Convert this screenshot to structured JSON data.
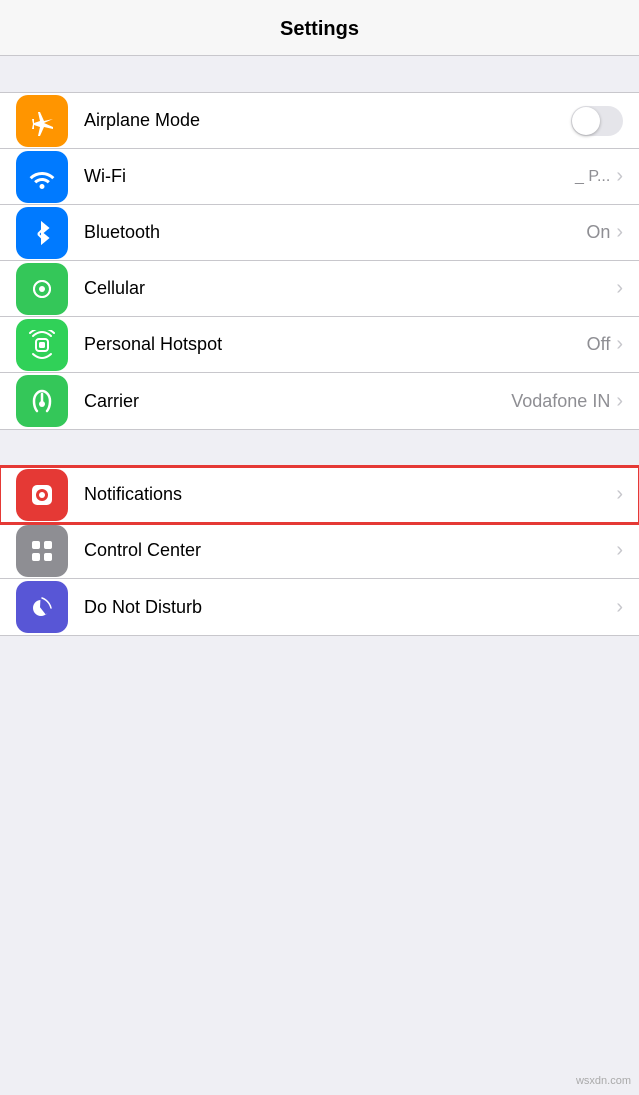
{
  "header": {
    "title": "Settings"
  },
  "groups": [
    {
      "id": "connectivity",
      "items": [
        {
          "id": "airplane-mode",
          "icon": "airplane",
          "icon_color": "orange",
          "label": "Airplane Mode",
          "value": "",
          "has_toggle": true,
          "toggle_on": false,
          "has_chevron": false
        },
        {
          "id": "wifi",
          "icon": "wifi",
          "icon_color": "blue",
          "label": "Wi-Fi",
          "value": "_ P...",
          "has_toggle": false,
          "has_chevron": true
        },
        {
          "id": "bluetooth",
          "icon": "bluetooth",
          "icon_color": "blue",
          "label": "Bluetooth",
          "value": "On",
          "has_toggle": false,
          "has_chevron": true
        },
        {
          "id": "cellular",
          "icon": "cellular",
          "icon_color": "green",
          "label": "Cellular",
          "value": "",
          "has_toggle": false,
          "has_chevron": true
        },
        {
          "id": "personal-hotspot",
          "icon": "hotspot",
          "icon_color": "green",
          "label": "Personal Hotspot",
          "value": "Off",
          "has_toggle": false,
          "has_chevron": true
        },
        {
          "id": "carrier",
          "icon": "carrier",
          "icon_color": "green",
          "label": "Carrier",
          "value": "Vodafone IN",
          "has_toggle": false,
          "has_chevron": true
        }
      ]
    },
    {
      "id": "system",
      "items": [
        {
          "id": "notifications",
          "icon": "notifications",
          "icon_color": "red",
          "label": "Notifications",
          "value": "",
          "has_toggle": false,
          "has_chevron": true,
          "highlighted": true
        },
        {
          "id": "control-center",
          "icon": "control-center",
          "icon_color": "gray",
          "label": "Control Center",
          "value": "",
          "has_toggle": false,
          "has_chevron": true
        },
        {
          "id": "do-not-disturb",
          "icon": "do-not-disturb",
          "icon_color": "purple",
          "label": "Do Not Disturb",
          "value": "",
          "has_toggle": false,
          "has_chevron": true
        }
      ]
    }
  ],
  "watermark": "wsxdn.com"
}
